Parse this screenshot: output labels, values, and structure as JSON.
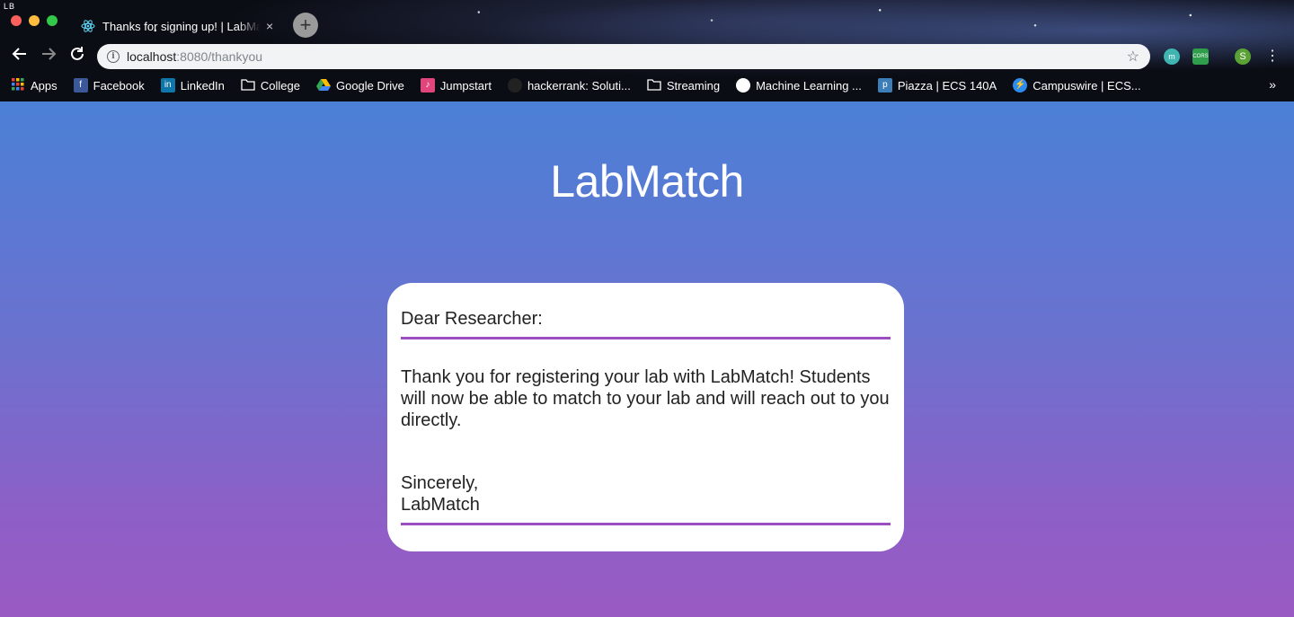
{
  "browser": {
    "corner_mark": "LB",
    "tab": {
      "title": "Thanks for signing up! | LabMatch",
      "close": "×"
    },
    "new_tab": "+",
    "omnibox": {
      "host": "localhost",
      "rest": ":8080/thankyou"
    },
    "extensions": {
      "m": "m",
      "cors": "CORS",
      "profile": "S"
    },
    "bookmarks": [
      {
        "label": "Apps",
        "icon": "apps-grid-icon",
        "color": "#e8453c"
      },
      {
        "label": "Facebook",
        "icon": "facebook-icon",
        "color": "#3b5998"
      },
      {
        "label": "LinkedIn",
        "icon": "linkedin-icon",
        "color": "#0e76a8"
      },
      {
        "label": "College",
        "icon": "folder-icon",
        "color": ""
      },
      {
        "label": "Google Drive",
        "icon": "google-drive-icon",
        "color": "#fbbc04"
      },
      {
        "label": "Jumpstart",
        "icon": "jumpstart-icon",
        "color": "#e0457b"
      },
      {
        "label": "hackerrank: Soluti...",
        "icon": "github-icon",
        "color": "#222"
      },
      {
        "label": "Streaming",
        "icon": "folder-icon",
        "color": ""
      },
      {
        "label": "Machine Learning ...",
        "icon": "ml-icon",
        "color": "#ffffff"
      },
      {
        "label": "Piazza | ECS 140A",
        "icon": "piazza-icon",
        "color": "#3d7eb9"
      },
      {
        "label": "Campuswire | ECS...",
        "icon": "campuswire-icon",
        "color": "#2d8cf0"
      }
    ],
    "more": "»"
  },
  "page": {
    "logo": "LabMatch",
    "letter": {
      "salutation": "Dear Researcher:",
      "body": "Thank you for registering your lab with LabMatch! Students will now be able to match to your lab and will reach out to you directly.",
      "closing": "Sincerely,",
      "signature": "LabMatch"
    }
  }
}
